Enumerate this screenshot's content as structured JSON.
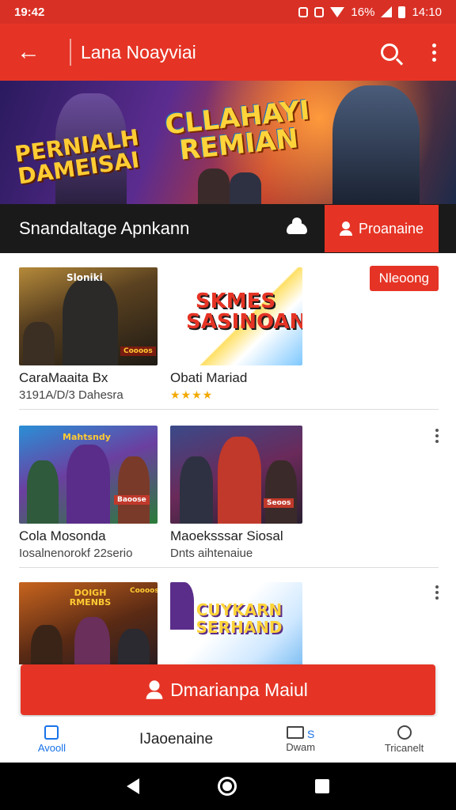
{
  "status_bar": {
    "time": "19:42",
    "battery": "16%",
    "clock": "14:10"
  },
  "app_bar": {
    "title": "Lana Noayviai",
    "back_icon": "arrow-left-icon",
    "search_icon": "search-icon",
    "more_icon": "more-vert-icon"
  },
  "banner": {
    "title_main": "CLLAHAYI REMIAN",
    "title_side": "PERNIALH DAMEISAI"
  },
  "section": {
    "label": "Snandaltage Apnkann",
    "icon": "cloud-icon",
    "promo_label": "Proanaine"
  },
  "badge": "Nleoong",
  "rows": [
    {
      "left": {
        "title": "CaraMaaita Bx",
        "subtitle": "3191A/D/3 Dahesra",
        "thumb_text": "Sloniki",
        "tag": "Coooos"
      },
      "right": {
        "title": "Obati Mariad",
        "rating": "★★★★",
        "thumb_text": "SKMES SASINOAN"
      }
    },
    {
      "left": {
        "title": "Cola Mosonda",
        "subtitle": "Iosalnenorokf 22serio",
        "thumb_text": "Mahtsndy",
        "tag": "Baoose"
      },
      "right": {
        "title": "Maoeksssar Siosal",
        "subtitle": "Dnts aihtenaiue",
        "tag": "Seoos"
      }
    },
    {
      "left": {
        "title": "",
        "thumb_text": "DOIGH RMENBS",
        "tag": "Coooos"
      },
      "right": {
        "title": "",
        "thumb_text": "CUYKARN SERHAND"
      }
    }
  ],
  "cta": {
    "label": "Dmarianpa Maiul"
  },
  "bottom_nav": [
    {
      "label": "Avooll",
      "icon": "home-icon",
      "active": true
    },
    {
      "label": "IJaoenaine"
    },
    {
      "label": "Dwam",
      "badge": "S",
      "icon": "gallery-icon"
    },
    {
      "label": "Tricanelt",
      "icon": "circle-icon"
    }
  ],
  "colors": {
    "primary": "#e53425",
    "accent": "#1a73e8",
    "dark": "#1a1a1a"
  }
}
